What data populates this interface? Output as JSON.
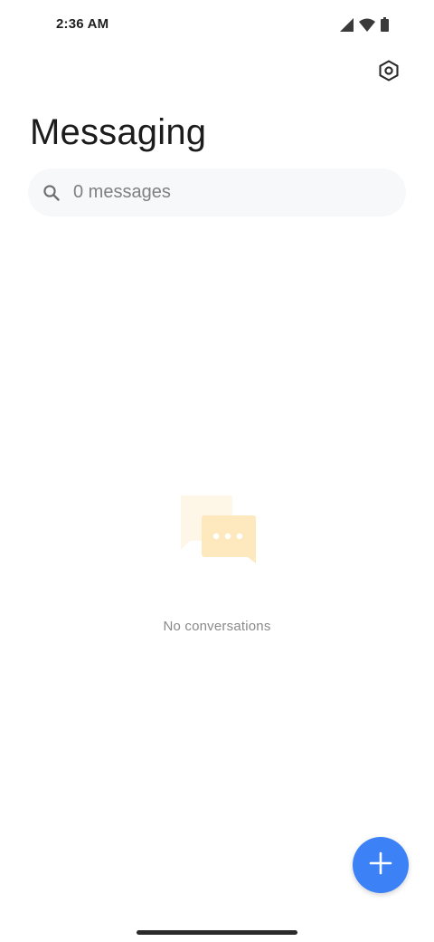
{
  "status_bar": {
    "time": "2:36 AM",
    "icons": [
      "signal-icon",
      "wifi-icon",
      "battery-icon"
    ]
  },
  "header": {
    "title": "Messaging",
    "settings_icon": "settings-icon"
  },
  "search": {
    "placeholder": "0 messages",
    "value": "",
    "icon": "search-icon"
  },
  "empty_state": {
    "text": "No conversations",
    "illustration": "chat-bubbles-icon"
  },
  "fab": {
    "icon": "plus-icon"
  },
  "colors": {
    "accent": "#3c82f6",
    "illustration": "#fde9bd",
    "search_bg": "#f7f8fa",
    "muted_text": "#8a8a8a"
  }
}
